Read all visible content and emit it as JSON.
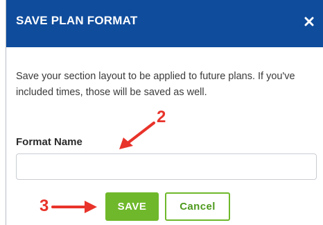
{
  "dialog": {
    "title": "SAVE PLAN FORMAT",
    "close_icon": "close-icon",
    "description": "Save your section layout to be applied to future plans. If you've included times, those will be saved as well.",
    "format_name_label": "Format Name",
    "format_name_value": "",
    "format_name_placeholder": "",
    "save_label": "SAVE",
    "cancel_label": "Cancel"
  },
  "annotations": {
    "step2": "2",
    "step3": "3",
    "arrow_icon": "red-arrow-icon"
  },
  "colors": {
    "header": "#0f4c9c",
    "accent_green": "#6fb82b",
    "annotation_red": "#e8332a"
  }
}
